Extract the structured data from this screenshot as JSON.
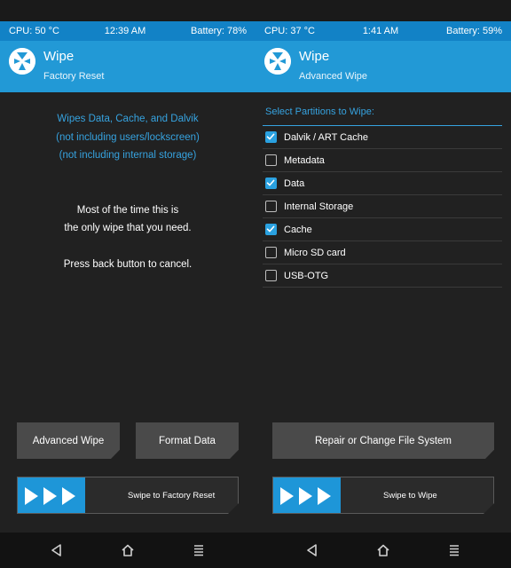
{
  "left": {
    "status": {
      "cpu": "CPU: 50 °C",
      "time": "12:39 AM",
      "battery": "Battery: 78%"
    },
    "header": {
      "title": "Wipe",
      "subtitle": "Factory Reset"
    },
    "info_lines": [
      "Wipes Data, Cache, and Dalvik",
      "(not including users/lockscreen)",
      "(not including internal storage)"
    ],
    "message_lines": [
      "Most of the time this is",
      "the only wipe that you need."
    ],
    "cancel_line": "Press back button to cancel.",
    "buttons": {
      "advanced": "Advanced Wipe",
      "format": "Format Data"
    },
    "swipe_label": "Swipe to Factory Reset"
  },
  "right": {
    "status": {
      "cpu": "CPU: 37 °C",
      "time": "1:41 AM",
      "battery": "Battery: 59%"
    },
    "header": {
      "title": "Wipe",
      "subtitle": "Advanced Wipe"
    },
    "select_title": "Select Partitions to Wipe:",
    "partitions": [
      {
        "label": "Dalvik / ART Cache",
        "checked": true
      },
      {
        "label": "Metadata",
        "checked": false
      },
      {
        "label": "Data",
        "checked": true
      },
      {
        "label": "Internal Storage",
        "checked": false
      },
      {
        "label": "Cache",
        "checked": true
      },
      {
        "label": "Micro SD card",
        "checked": false
      },
      {
        "label": "USB-OTG",
        "checked": false
      }
    ],
    "repair_button": "Repair or Change File System",
    "swipe_label": "Swipe to Wipe"
  },
  "nav_icons": [
    "back-icon",
    "home-icon",
    "menu-icon"
  ],
  "colors": {
    "accent": "#2299d6",
    "status_bar": "#1282c6",
    "info_text": "#36a3e0",
    "background": "#212121",
    "button": "#4a4a4a"
  }
}
